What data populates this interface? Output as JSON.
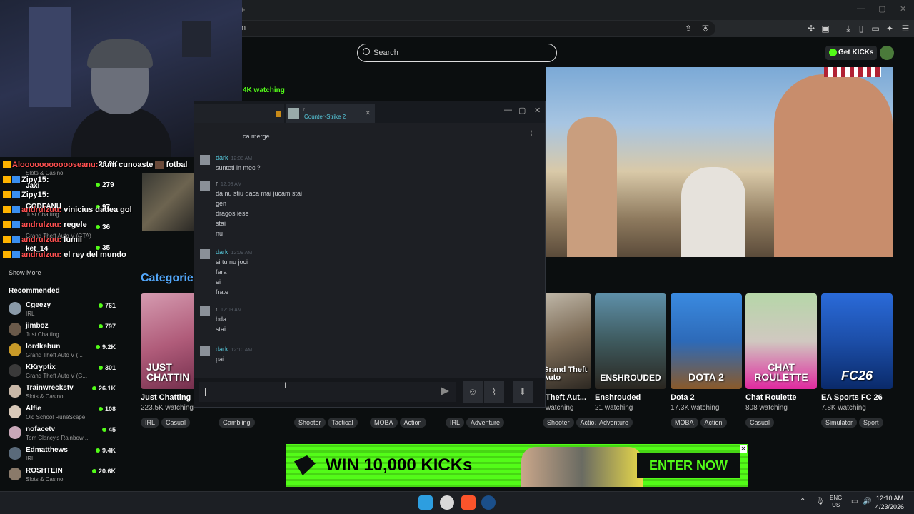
{
  "browser": {
    "url_fragment": "n",
    "tab_add": "+"
  },
  "header": {
    "search_placeholder": "Search",
    "get_kicks": "Get KICKs"
  },
  "stream": {
    "watching": "4K watching"
  },
  "overlay_chat": [
    {
      "user": "Zipy15:",
      "text": ""
    },
    {
      "user": "Zipy15:",
      "text": ""
    },
    {
      "user": "andrulzuu:",
      "text": "vinicius dadea gol"
    },
    {
      "user": "andrulzuu:",
      "text": "regele"
    },
    {
      "user": "andrulzuu:",
      "text": "lumii"
    },
    {
      "user": "andrulzuu:",
      "text": "el rey del mundo"
    }
  ],
  "overlay_top": {
    "user": "Aloooooooooooseanu:",
    "text": "cum cunoaste",
    "text2": "fotbal"
  },
  "top_sidebar": [
    {
      "name": "",
      "category": "Slots & Casino",
      "viewers": "26.9K"
    },
    {
      "name": "Jaxi",
      "category": "",
      "viewers": "279"
    },
    {
      "name": "GODFANU",
      "category": "Just Chatting",
      "viewers": "97"
    },
    {
      "name": "",
      "category": "Grand Theft Auto V (GTA)",
      "viewers": "36"
    },
    {
      "name": "ket_14",
      "category": "",
      "viewers": "35"
    }
  ],
  "sidebar": {
    "show_more": "Show More",
    "recommended_title": "Recommended",
    "recommended": [
      {
        "name": "Cgeezy",
        "category": "IRL",
        "viewers": "761"
      },
      {
        "name": "jimboz",
        "category": "Just Chatting",
        "viewers": "797"
      },
      {
        "name": "lordkebun",
        "category": "Grand Theft Auto V (...",
        "viewers": "9.2K"
      },
      {
        "name": "KKryptix",
        "category": "Grand Theft Auto V (G...",
        "viewers": "301"
      },
      {
        "name": "Trainwreckstv",
        "category": "Slots & Casino",
        "viewers": "26.1K"
      },
      {
        "name": "Alfie",
        "category": "Old School RuneScape",
        "viewers": "108"
      },
      {
        "name": "nofacetv",
        "category": "Tom Clancy's Rainbow ...",
        "viewers": "45"
      },
      {
        "name": "Edmatthews",
        "category": "IRL",
        "viewers": "9.4K"
      },
      {
        "name": "ROSHTEIN",
        "category": "Slots & Casino",
        "viewers": "20.6K"
      }
    ]
  },
  "categories": {
    "title": "Categorie",
    "cards": [
      {
        "title": "Just Chatting",
        "art_label": "JUST CHATTIN",
        "watching": "223.5K watching",
        "tags": [
          "IRL",
          "Casual"
        ]
      },
      {
        "title": "Theft Aut...",
        "art_label": "Grand Theft Auto",
        "watching": "watching",
        "tags": [
          "Shooter",
          "Action"
        ]
      },
      {
        "title": "Enshrouded",
        "art_label": "ENSHROUDED",
        "watching": "21 watching",
        "tags": [
          "Adventure"
        ]
      },
      {
        "title": "Dota 2",
        "art_label": "DOTA 2",
        "watching": "17.3K watching",
        "tags": [
          "MOBA",
          "Action"
        ]
      },
      {
        "title": "Chat Roulette",
        "art_label": "CHAT ROULETTE",
        "watching": "808 watching",
        "tags": [
          "Casual"
        ]
      },
      {
        "title": "EA Sports FC 26",
        "art_label": "FC26",
        "watching": "7.8K watching",
        "tags": [
          "Simulator",
          "Sport"
        ]
      }
    ],
    "hidden_tags": [
      "Gambling",
      "Shooter",
      "Tactical",
      "MOBA",
      "Action",
      "IRL",
      "Adventure"
    ]
  },
  "banner": {
    "headline": "WIN 10,000 KICKs",
    "cta": "ENTER NOW"
  },
  "steam_chat": {
    "tab_name": "r",
    "tab_game": "Counter-Strike 2",
    "first_line": "ca merge",
    "messages": [
      {
        "user": "dark",
        "time": "12:08 AM",
        "lines": [
          "sunteti in meci?"
        ]
      },
      {
        "user": "r",
        "time": "12:08 AM",
        "lines": [
          "da nu stiu daca mai jucam stai",
          "gen",
          "dragos iese",
          "stai",
          "nu"
        ]
      },
      {
        "user": "dark",
        "time": "12:09 AM",
        "lines": [
          "si tu nu joci",
          "fara",
          "ei",
          "frate"
        ]
      },
      {
        "user": "r",
        "time": "12:09 AM",
        "lines": [
          "bda",
          "stai"
        ]
      },
      {
        "user": "dark",
        "time": "12:10 AM",
        "lines": [
          "pai"
        ]
      }
    ]
  },
  "taskbar": {
    "lang": "ENG",
    "region": "US",
    "time": "12:10 AM",
    "date": "4/23/2026"
  }
}
